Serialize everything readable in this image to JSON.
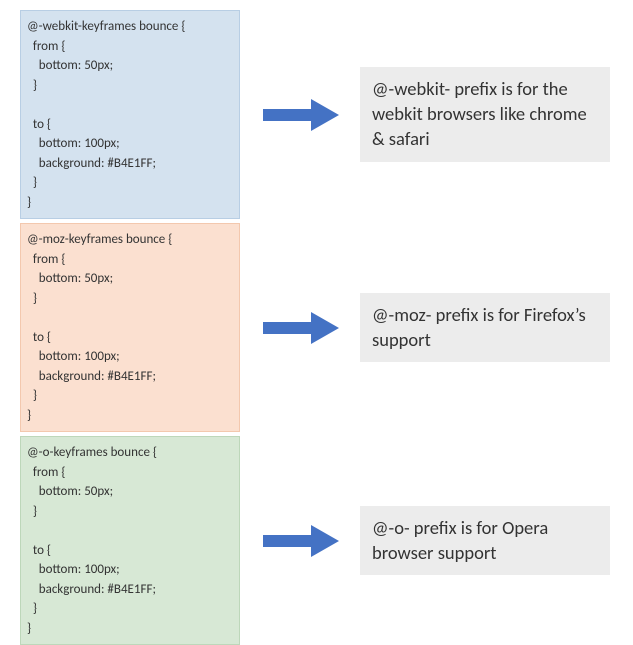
{
  "blocks": [
    {
      "bg": "blue",
      "code": "@-webkit-keyframes bounce {\n  from {\n    bottom: 50px;\n  }\n\n  to {\n    bottom: 100px;\n    background: #B4E1FF;\n  }\n}",
      "desc": "@-webkit- prefix is for the webkit browsers like chrome & safari"
    },
    {
      "bg": "orange",
      "code": "@-moz-keyframes bounce {\n  from {\n    bottom: 50px;\n  }\n\n  to {\n    bottom: 100px;\n    background: #B4E1FF;\n  }\n}",
      "desc": "@-moz- prefix is for Firefox’s support"
    },
    {
      "bg": "green",
      "code": "@-o-keyframes bounce {\n  from {\n    bottom: 50px;\n  }\n\n  to {\n    bottom: 100px;\n    background: #B4E1FF;\n  }\n}",
      "desc": "@-o- prefix is for Opera browser support"
    }
  ],
  "arrowColor": "#4472c4"
}
